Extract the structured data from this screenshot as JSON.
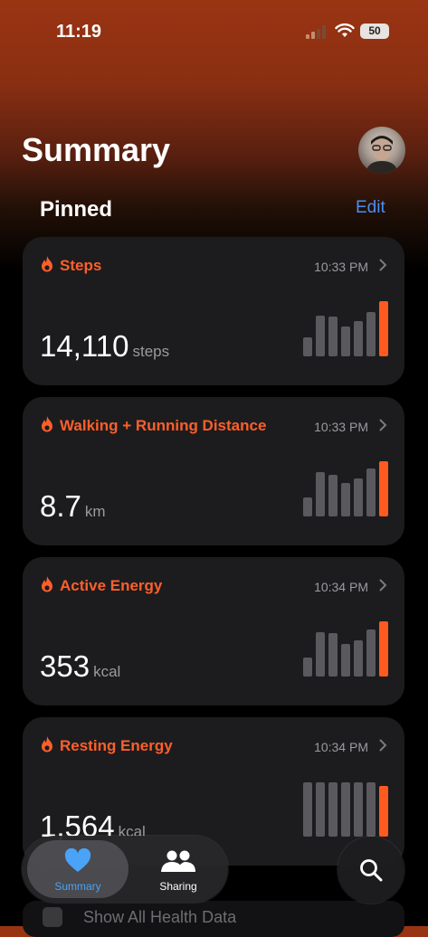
{
  "status_bar": {
    "time": "11:19",
    "battery": "50"
  },
  "header": {
    "title": "Summary"
  },
  "pinned": {
    "label": "Pinned",
    "edit_label": "Edit"
  },
  "cards": [
    {
      "title": "Steps",
      "time": "10:33 PM",
      "value": "14,110",
      "unit": "steps",
      "accent": "#ff5f2a"
    },
    {
      "title": "Walking + Running Distance",
      "time": "10:33 PM",
      "value": "8.7",
      "unit": "km",
      "accent": "#ff5f2a"
    },
    {
      "title": "Active Energy",
      "time": "10:34 PM",
      "value": "353",
      "unit": "kcal",
      "accent": "#ff5f2a"
    },
    {
      "title": "Resting Energy",
      "time": "10:34 PM",
      "value": "1,564",
      "unit": "kcal",
      "accent": "#ff5f2a"
    }
  ],
  "show_all": {
    "label": "Show All Health Data"
  },
  "tabbar": {
    "tabs": [
      {
        "label": "Summary",
        "icon": "heart-icon",
        "selected": true
      },
      {
        "label": "Sharing",
        "icon": "people-icon",
        "selected": false
      }
    ],
    "search_icon": "search-icon"
  },
  "colors": {
    "accent": "#ff5a1f",
    "link": "#4a8ff0",
    "selected_tab": "#4aa3f7"
  }
}
